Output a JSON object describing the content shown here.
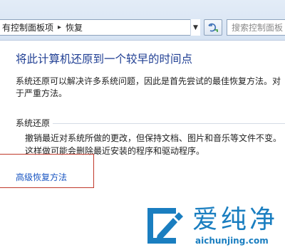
{
  "address_bar": {
    "breadcrumb_parent": "有控制面板项",
    "breadcrumb_separator": "▸",
    "breadcrumb_current": "恢复",
    "search_placeholder": "搜索控制面板"
  },
  "main": {
    "heading": "将此计算机还原到一个较早的时间点",
    "description": "系统还原可以解决许多系统问题，因此是首先尝试的最佳恢复方法。对于严重方法。",
    "system_restore": {
      "label": "系统还原",
      "description": "撤销最近对系统所做的更改，但保持文档、图片和音乐等文件不变。这样做可能会删除最近安装的程序和驱动程序。"
    },
    "advanced_link": "高级恢复方法"
  },
  "watermark": {
    "text": "爱纯净",
    "url": "aichunjing.com"
  },
  "colors": {
    "heading": "#1f3e93",
    "link": "#1a56c2",
    "highlight_box": "#c0392b",
    "watermark": "#1a7ec0"
  }
}
